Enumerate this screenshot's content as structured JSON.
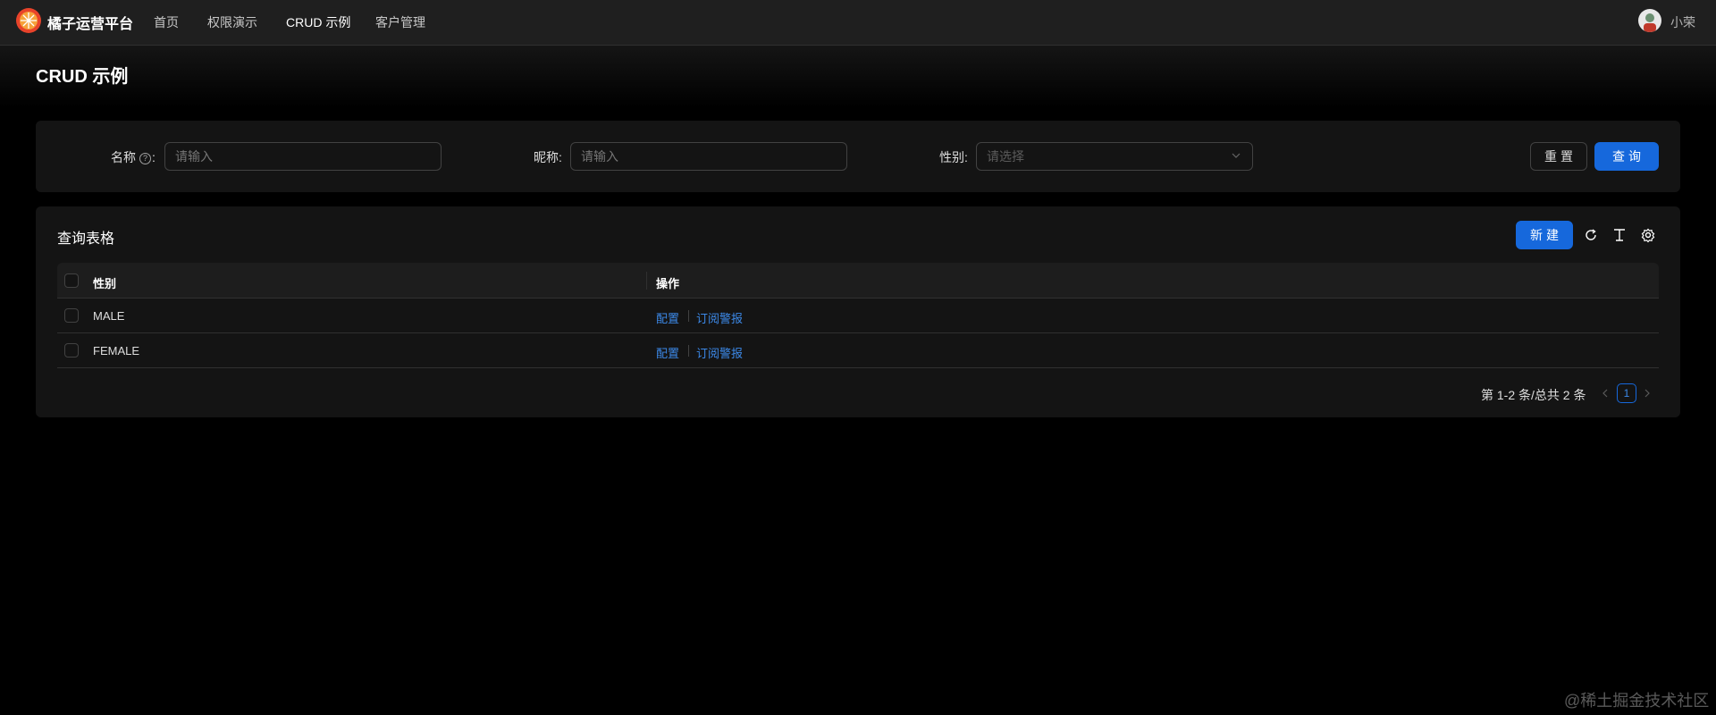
{
  "nav": {
    "brand": "橘子运营平台",
    "items": [
      "首页",
      "权限演示",
      "CRUD 示例",
      "客户管理"
    ],
    "user": "小荣"
  },
  "page": {
    "title": "CRUD 示例"
  },
  "search": {
    "name_label": "名称",
    "name_placeholder": "请输入",
    "nickname_label": "昵称:",
    "nickname_placeholder": "请输入",
    "gender_label": "性别:",
    "gender_placeholder": "请选择",
    "reset_label": "重置",
    "submit_label": "查询"
  },
  "table": {
    "title": "查询表格",
    "new_label": "新建",
    "columns": [
      "性别",
      "操作"
    ],
    "rows": [
      {
        "gender": "MALE",
        "actions": [
          "配置",
          "订阅警报"
        ]
      },
      {
        "gender": "FEMALE",
        "actions": [
          "配置",
          "订阅警报"
        ]
      }
    ]
  },
  "pagination": {
    "total_text": "第 1-2 条/总共 2 条",
    "current": "1"
  },
  "watermark": "@稀土掘金技术社区",
  "colors": {
    "primary": "#1668dc",
    "link": "#3c89e8",
    "background": "#000000",
    "card": "#141414"
  },
  "icons": [
    "logo-icon",
    "avatar-icon",
    "help-icon",
    "chevron-down-icon",
    "reload-icon",
    "column-height-icon",
    "setting-icon",
    "left-icon",
    "right-icon"
  ]
}
